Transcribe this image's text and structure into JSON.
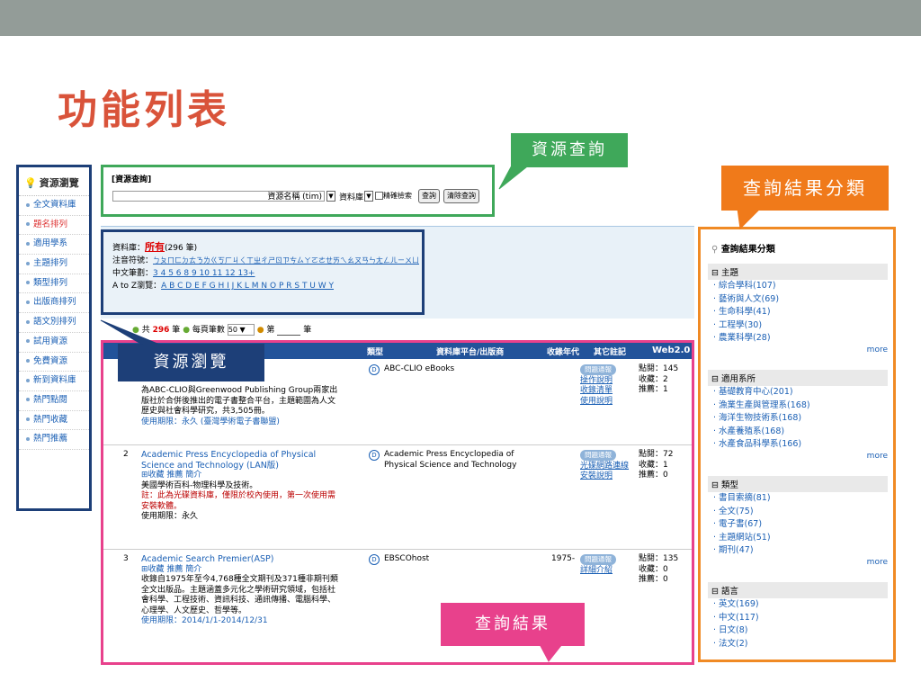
{
  "slide": {
    "title": "功能列表"
  },
  "sidebar": {
    "title": "資源瀏覽",
    "items": [
      "全文資料庫",
      "題名排列",
      "適用學系",
      "主題排列",
      "類型排列",
      "出版商排列",
      "語文別排列",
      "試用資源",
      "免費資源",
      "新到資料庫",
      "熱門點閱",
      "熱門收藏",
      "熱門推薦"
    ]
  },
  "search": {
    "label": "[資源查詢]",
    "field": "資源名稱 (tim)",
    "type": "資料庫",
    "exact": "精確檢索",
    "btn_search": "查詢",
    "btn_reset": "清除查詢"
  },
  "browse": {
    "db_label": "資料庫：",
    "all": "所有",
    "count": "(296 筆)",
    "zhuyin_label": "注音符號：",
    "zhuyin": "ㄅㄆㄇㄈㄉㄊㄋㄌㄍㄎㄏㄐㄑㄒㄓㄔㄕㄖㄗㄘㄙㄚㄛㄜㄝㄞㄟㄠㄡㄢㄣㄤㄥㄦㄧㄨㄩ",
    "stroke_label": "中文筆劃：",
    "strokes": "3 4 5 6 8 9 10 11 12 13+",
    "az_label": "A to Z瀏覽：",
    "az": "A B C D E F G H I J K L M N O P R S T U W Y"
  },
  "pager": {
    "total_prefix": "共",
    "total": "296",
    "total_suffix": "筆",
    "per_page_label": "每頁筆數",
    "per_page": "50",
    "page_prefix": "第",
    "page_suffix": "筆"
  },
  "table": {
    "headers": [
      "類型",
      "資料庫平台/出版商",
      "收錄年代",
      "其它註記",
      "Web2.0"
    ],
    "rows": [
      {
        "no": "",
        "name": "",
        "tools": "",
        "desc": "為ABC-CLIO與Greenwood Publishing Group兩家出版社於合併後推出的電子書整合平台，主題範圍為人文歷史與社會科學研究，共3,505冊。",
        "note": "",
        "period": "使用期限：永久 (臺灣學術電子書聯盟)",
        "platform": "ABC-CLIO eBooks",
        "year": "",
        "badge": "問題通報",
        "others": [
          "操作說明",
          "收錄清單",
          "使用說明"
        ],
        "stats": [
          "點閱：145",
          "收藏：2",
          "推薦：1"
        ]
      },
      {
        "no": "2",
        "name": "Academic Press Encyclopedia of Physical Science and Technology (LAN版)",
        "tools": "⊞收藏 推薦 簡介",
        "desc": "美國學術百科-物理科學及技術。",
        "note": "註：此為光碟資料庫，僅限於校內使用，第一次使用需安裝軟體。",
        "period": "使用期限：永久",
        "platform": "Academic Press Encyclopedia of Physical Science and Technology",
        "year": "",
        "badge": "問題通報",
        "others": [
          "光碟網路連線安裝說明"
        ],
        "stats": [
          "點閱：72",
          "收藏：1",
          "推薦：0"
        ]
      },
      {
        "no": "3",
        "name": "Academic Search Premier(ASP)",
        "tools": "⊞收藏 推薦 簡介",
        "desc": "收錄自1975年至今4,768種全文期刊及371種非期刊類全文出版品。主題涵蓋多元化之學術研究領域，包括社會科學、工程技術、資訊科技、通訊傳播、電腦科學、心理學、人文歷史、哲學等。",
        "note": "",
        "period": "使用期限：2014/1/1-2014/12/31",
        "platform": "EBSCOhost",
        "year": "1975-",
        "badge": "問題通報",
        "others": [
          "詳細介紹"
        ],
        "stats": [
          "點閱：135",
          "收藏：0",
          "推薦：0"
        ]
      }
    ]
  },
  "facets": {
    "title": "查詢結果分類",
    "more": "more",
    "sections": [
      {
        "name": "⊟ 主題",
        "items": [
          "綜合學科(107)",
          "藝術與人文(69)",
          "生命科學(41)",
          "工程學(30)",
          "農業科學(28)"
        ]
      },
      {
        "name": "⊟ 適用系所",
        "items": [
          "基礎教育中心(201)",
          "漁業生產與管理系(168)",
          "海洋生物技術系(168)",
          "水產養殖系(168)",
          "水產食品科學系(166)"
        ]
      },
      {
        "name": "⊟ 類型",
        "items": [
          "書目索摘(81)",
          "全文(75)",
          "電子書(67)",
          "主題網站(51)",
          "期刊(47)"
        ]
      },
      {
        "name": "⊟ 語言",
        "items": [
          "英文(169)",
          "中文(117)",
          "日文(8)",
          "法文(2)"
        ]
      }
    ]
  },
  "callouts": {
    "search": "資源查詢",
    "facets": "查詢結果分類",
    "browse": "資源瀏覽",
    "results": "查詢結果"
  }
}
